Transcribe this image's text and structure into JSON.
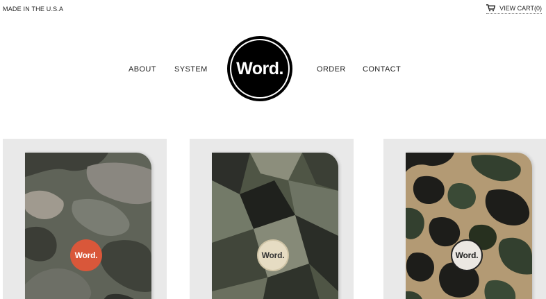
{
  "header": {
    "made_in": "MADE IN THE U.S.A",
    "cart_label": "VIEW CART(0)"
  },
  "nav": {
    "about": "ABOUT",
    "system": "SYSTEM",
    "order": "ORDER",
    "contact": "CONTACT"
  },
  "logo": {
    "text": "Word."
  },
  "products": [
    {
      "badge": "Word.",
      "pattern": "camo-woodland",
      "badge_color": "#d9573a"
    },
    {
      "badge": "Word.",
      "pattern": "camo-geometric",
      "badge_color": "#e6dcc3"
    },
    {
      "badge": "Word.",
      "pattern": "camo-duck",
      "badge_color": "#ebe7e2"
    }
  ]
}
